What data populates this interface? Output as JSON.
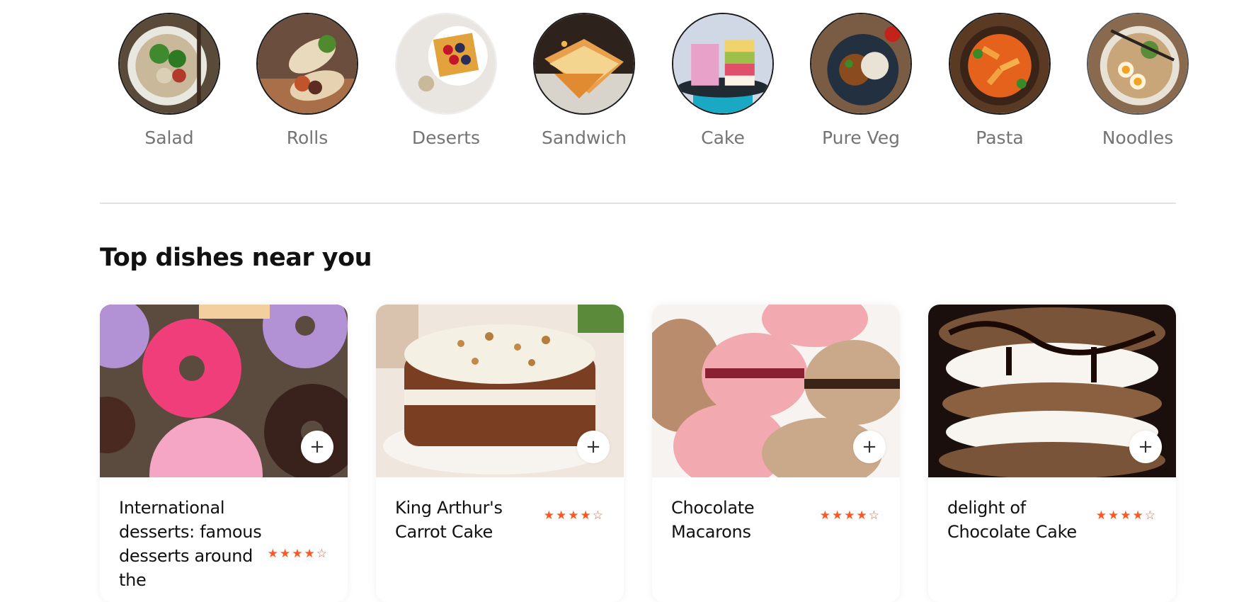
{
  "menu": {
    "items": [
      {
        "label": "Salad",
        "icon": "salad-photo"
      },
      {
        "label": "Rolls",
        "icon": "rolls-photo"
      },
      {
        "label": "Deserts",
        "icon": "deserts-photo"
      },
      {
        "label": "Sandwich",
        "icon": "sandwich-photo"
      },
      {
        "label": "Cake",
        "icon": "cake-photo"
      },
      {
        "label": "Pure Veg",
        "icon": "pure-veg-photo"
      },
      {
        "label": "Pasta",
        "icon": "pasta-photo"
      },
      {
        "label": "Noodles",
        "icon": "noodles-photo"
      }
    ]
  },
  "section": {
    "title": "Top dishes near you"
  },
  "dishes": [
    {
      "name": "International desserts: famous desserts around the",
      "rating": "★★★★☆",
      "add_label": "+"
    },
    {
      "name": "King Arthur's Carrot Cake",
      "rating": "★★★★☆",
      "add_label": "+"
    },
    {
      "name": "Chocolate Macarons",
      "rating": "★★★★☆",
      "add_label": "+"
    },
    {
      "name": "delight of Chocolate Cake",
      "rating": "★★★★☆",
      "add_label": "+"
    }
  ],
  "colors": {
    "accent": "#ff5722",
    "divider": "#e2e2e2",
    "label": "#747474"
  }
}
